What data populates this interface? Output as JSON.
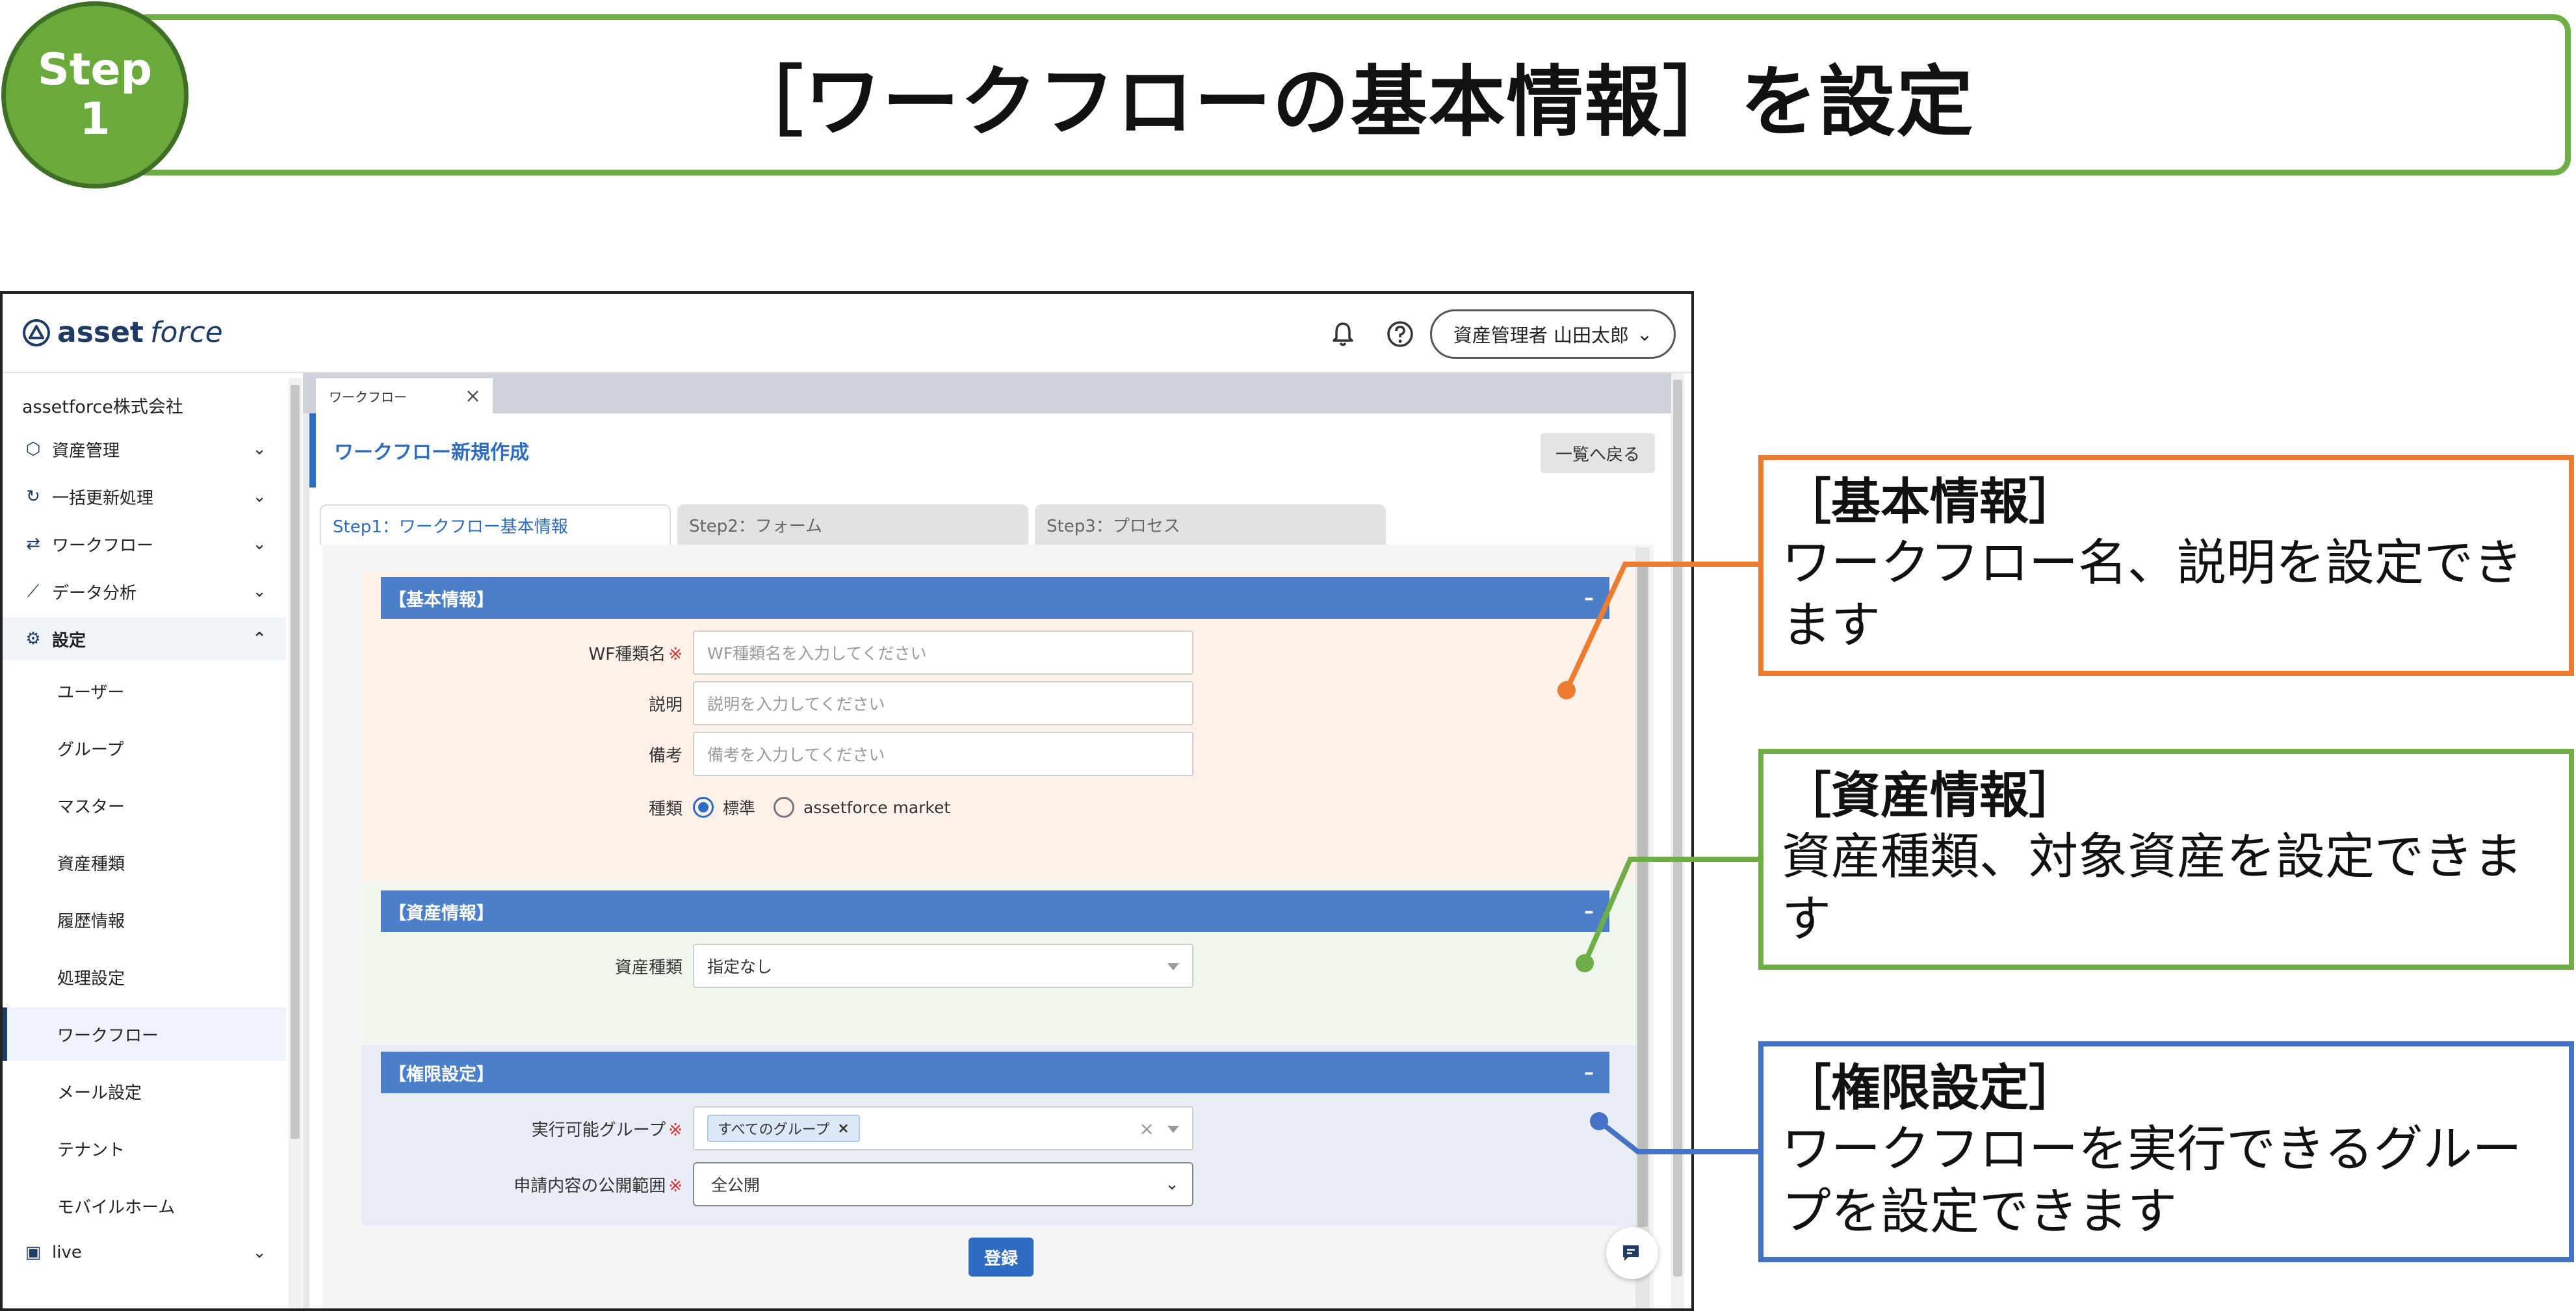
{
  "step": {
    "label_line1": "Step",
    "label_line2": "1",
    "title": "［ワークフローの基本情報］を設定"
  },
  "header": {
    "logo_bold": "asset",
    "logo_italic": "force",
    "user_button": "資産管理者 山田太郎"
  },
  "sidebar": {
    "company": "assetforce株式会社",
    "items": [
      {
        "label": "資産管理",
        "icon": "cube-icon"
      },
      {
        "label": "一括更新処理",
        "icon": "refresh-icon"
      },
      {
        "label": "ワークフロー",
        "icon": "workflow-icon"
      },
      {
        "label": "データ分析",
        "icon": "analytics-icon"
      },
      {
        "label": "設定",
        "icon": "gear-icon"
      }
    ],
    "sub_items": [
      "ユーザー",
      "グループ",
      "マスター",
      "資産種類",
      "履歴情報",
      "処理設定",
      "ワークフロー",
      "メール設定",
      "テナント",
      "モバイルホーム"
    ],
    "last_item": {
      "label": "live",
      "icon": "chat-icon"
    }
  },
  "main": {
    "doc_tab": "ワークフロー",
    "page_title": "ワークフロー新規作成",
    "back_button": "一覧へ戻る",
    "wizard_tabs": [
      "Step1：ワークフロー基本情報",
      "Step2：フォーム",
      "Step3：プロセス"
    ],
    "sections": {
      "basic": {
        "header": "【基本情報】",
        "wf_name_label": "WF種類名",
        "wf_name_placeholder": "WF種類名を入力してください",
        "desc_label": "説明",
        "desc_placeholder": "説明を入力してください",
        "note_label": "備考",
        "note_placeholder": "備考を入力してください",
        "type_label": "種類",
        "type_options": [
          "標準",
          "assetforce market"
        ]
      },
      "asset": {
        "header": "【資産情報】",
        "asset_type_label": "資産種類",
        "asset_type_value": "指定なし"
      },
      "perm": {
        "header": "【権限設定】",
        "group_label": "実行可能グループ",
        "group_chip": "すべてのグループ",
        "scope_label": "申請内容の公開範囲",
        "scope_value": "全公開"
      }
    },
    "required_mark": "※",
    "collapse_mark": "–",
    "register_button": "登録"
  },
  "callouts": {
    "basic": {
      "title": "［基本情報］",
      "body": "ワークフロー名、説明を設定できます"
    },
    "asset": {
      "title": "［資産情報］",
      "body": "資産種類、対象資産を設定できます"
    },
    "perm": {
      "title": "［権限設定］",
      "body": "ワークフローを実行できるグループを設定できます"
    }
  },
  "colors": {
    "orange": "#ec7c30",
    "green": "#6fad47",
    "blue": "#4472c4",
    "accent": "#2d6cc0"
  }
}
